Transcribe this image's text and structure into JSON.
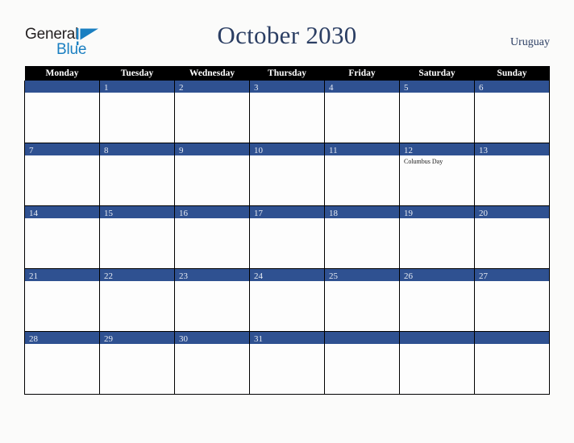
{
  "brand": {
    "name_part1": "General",
    "name_part2": "Blue",
    "mark": "triangle-flag-icon",
    "color_dark": "#231f20",
    "color_blue": "#1a7fc1"
  },
  "header": {
    "title": "October 2030",
    "country": "Uruguay"
  },
  "theme": {
    "header_bar": "#000000",
    "day_bar": "#2f5191",
    "title_color": "#2b3e63",
    "page_background": "#fbfbfa",
    "cell_background": "#fdfdfd",
    "grid_line": "#000000"
  },
  "calendar": {
    "month": "October",
    "year": "2030",
    "weekday_headers": [
      "Monday",
      "Tuesday",
      "Wednesday",
      "Thursday",
      "Friday",
      "Saturday",
      "Sunday"
    ],
    "weeks": [
      [
        {
          "day": "",
          "events": []
        },
        {
          "day": "1",
          "events": []
        },
        {
          "day": "2",
          "events": []
        },
        {
          "day": "3",
          "events": []
        },
        {
          "day": "4",
          "events": []
        },
        {
          "day": "5",
          "events": []
        },
        {
          "day": "6",
          "events": []
        }
      ],
      [
        {
          "day": "7",
          "events": []
        },
        {
          "day": "8",
          "events": []
        },
        {
          "day": "9",
          "events": []
        },
        {
          "day": "10",
          "events": []
        },
        {
          "day": "11",
          "events": []
        },
        {
          "day": "12",
          "events": [
            "Columbus Day"
          ]
        },
        {
          "day": "13",
          "events": []
        }
      ],
      [
        {
          "day": "14",
          "events": []
        },
        {
          "day": "15",
          "events": []
        },
        {
          "day": "16",
          "events": []
        },
        {
          "day": "17",
          "events": []
        },
        {
          "day": "18",
          "events": []
        },
        {
          "day": "19",
          "events": []
        },
        {
          "day": "20",
          "events": []
        }
      ],
      [
        {
          "day": "21",
          "events": []
        },
        {
          "day": "22",
          "events": []
        },
        {
          "day": "23",
          "events": []
        },
        {
          "day": "24",
          "events": []
        },
        {
          "day": "25",
          "events": []
        },
        {
          "day": "26",
          "events": []
        },
        {
          "day": "27",
          "events": []
        }
      ],
      [
        {
          "day": "28",
          "events": []
        },
        {
          "day": "29",
          "events": []
        },
        {
          "day": "30",
          "events": []
        },
        {
          "day": "31",
          "events": []
        },
        {
          "day": "",
          "events": []
        },
        {
          "day": "",
          "events": []
        },
        {
          "day": "",
          "events": []
        }
      ]
    ],
    "holidays": [
      {
        "date": "12",
        "name": "Columbus Day"
      }
    ]
  }
}
